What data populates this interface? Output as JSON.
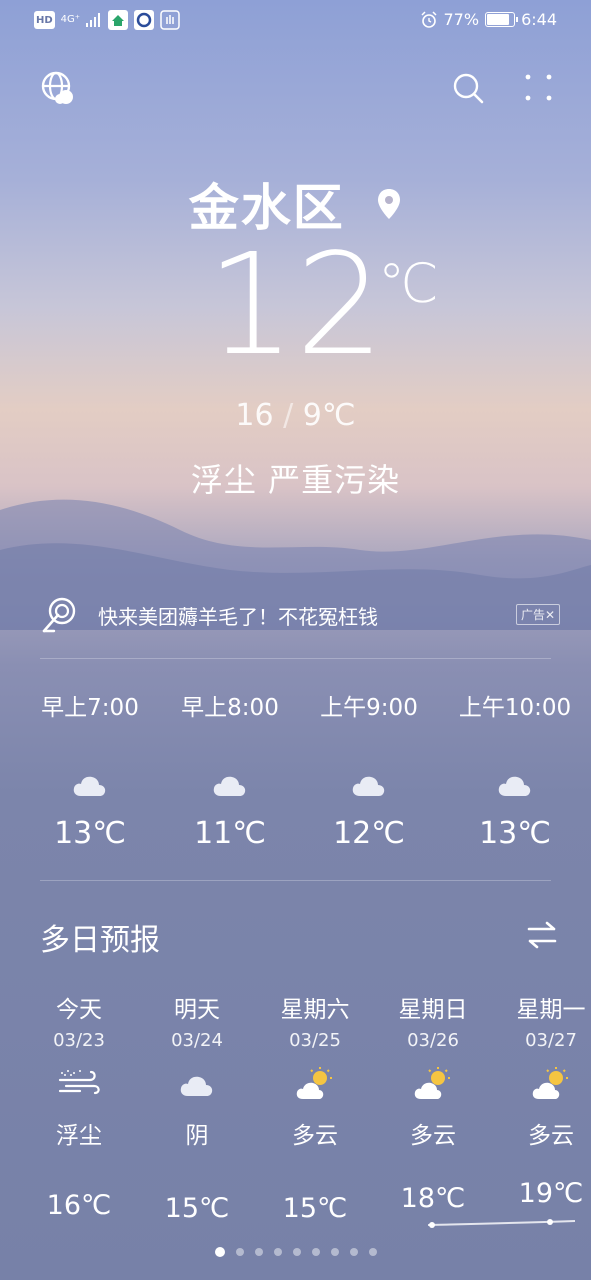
{
  "status_bar": {
    "left_badges": [
      "HD",
      "4G⁺"
    ],
    "battery": "77%",
    "battery_level": 0.77,
    "time": "6:44"
  },
  "location": {
    "city": "金水区",
    "current_temp": "12",
    "temp_unit": "℃",
    "high": "16",
    "low": "9℃",
    "separator": "/",
    "air_quality": "浮尘 严重污染"
  },
  "ad": {
    "text": "快来美团薅羊毛了！不花冤枉钱",
    "tag": "广告✕"
  },
  "hourly": [
    {
      "time": "早上7:00",
      "temp": "13℃",
      "icon": "cloudy-icon"
    },
    {
      "time": "早上8:00",
      "temp": "11℃",
      "icon": "cloudy-icon"
    },
    {
      "time": "上午9:00",
      "temp": "12℃",
      "icon": "cloudy-icon"
    },
    {
      "time": "上午10:00",
      "temp": "13℃",
      "icon": "cloudy-icon"
    }
  ],
  "forecast": {
    "title": "多日预报",
    "days": [
      {
        "name": "今天",
        "date": "03/23",
        "weather": "浮尘",
        "high": "16℃",
        "icon": "dust-wind-icon"
      },
      {
        "name": "明天",
        "date": "03/24",
        "weather": "阴",
        "high": "15℃",
        "icon": "overcast-icon"
      },
      {
        "name": "星期六",
        "date": "03/25",
        "weather": "多云",
        "high": "15℃",
        "icon": "partly-cloudy-icon"
      },
      {
        "name": "星期日",
        "date": "03/26",
        "weather": "多云",
        "high": "18℃",
        "icon": "partly-cloudy-icon"
      },
      {
        "name": "星期一",
        "date": "03/27",
        "weather": "多云",
        "high": "19℃",
        "icon": "partly-cloudy-icon"
      }
    ]
  },
  "pager": {
    "count": 9,
    "active": 0
  },
  "colors": {
    "accent_sun": "#f5c542",
    "cloud": "#ffffff"
  }
}
